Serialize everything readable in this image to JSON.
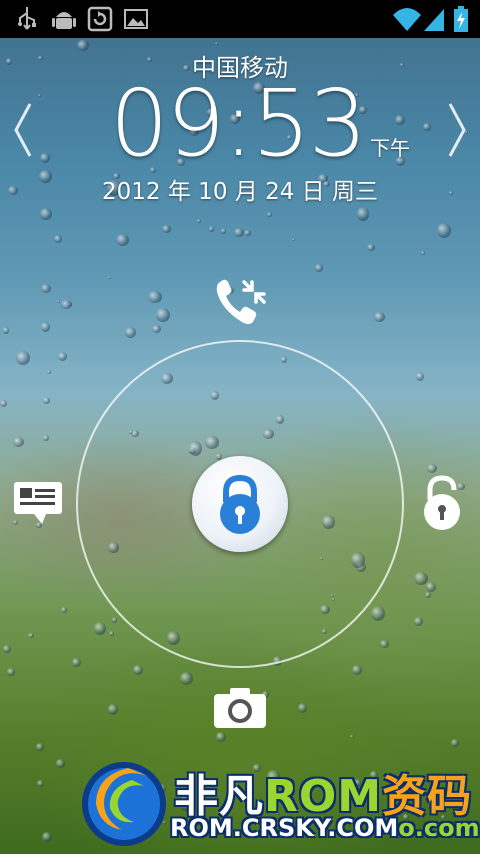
{
  "status_bar": {
    "left_icons": [
      "usb-icon",
      "android-debug-icon",
      "rotate-icon",
      "image-icon"
    ],
    "right_icons": [
      "wifi-icon",
      "signal-icon",
      "battery-charging-icon"
    ]
  },
  "lockscreen": {
    "carrier": "中国移动",
    "time": "09:53",
    "ampm": "下午",
    "date": "2012 年 10 月 24 日 周三"
  },
  "targets": {
    "top": "phone-missed-icon",
    "left": "message-icon",
    "right": "unlock-icon",
    "bottom": "camera-icon",
    "center": "lock-icon"
  },
  "watermark": {
    "brand_prefix": "非凡",
    "brand_rom": "ROM",
    "brand_suffix": "资码",
    "url": "ROM.CRSKY.COM",
    "url_tail": "o.com"
  },
  "colors": {
    "lock_blue": "#2a7fd6",
    "ring": "#ffffff"
  }
}
